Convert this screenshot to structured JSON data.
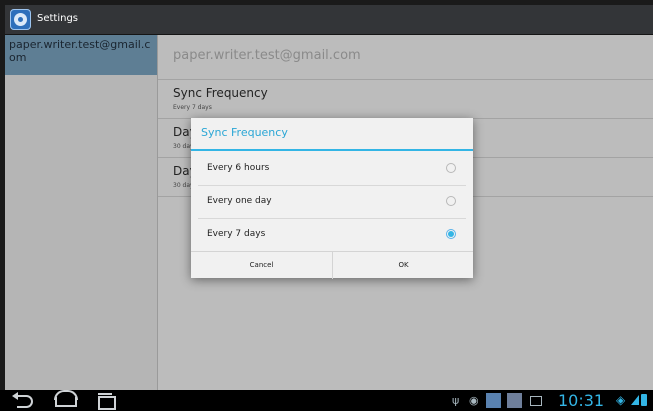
{
  "app": {
    "title": "Settings",
    "icon": "settings-app-icon"
  },
  "sidebar": {
    "account": "paper.writer.test@gmail.com"
  },
  "main": {
    "account_title": "paper.writer.test@gmail.com",
    "prefs": [
      {
        "title": "Sync Frequency",
        "summary": "Every 7 days"
      },
      {
        "title": "Days to sync",
        "summary": "30 days"
      },
      {
        "title": "Days to sync",
        "summary": "30 days"
      }
    ]
  },
  "dialog": {
    "title": "Sync Frequency",
    "options": [
      {
        "label": "Every 6 hours",
        "selected": false
      },
      {
        "label": "Every one day",
        "selected": false
      },
      {
        "label": "Every 7 days",
        "selected": true
      }
    ],
    "cancel_label": "Cancel",
    "ok_label": "OK"
  },
  "statusbar": {
    "time": "10:31"
  },
  "colors": {
    "accent": "#33b5e5",
    "sidebar_selected": "#5e7e94",
    "actionbar": "#333538"
  }
}
